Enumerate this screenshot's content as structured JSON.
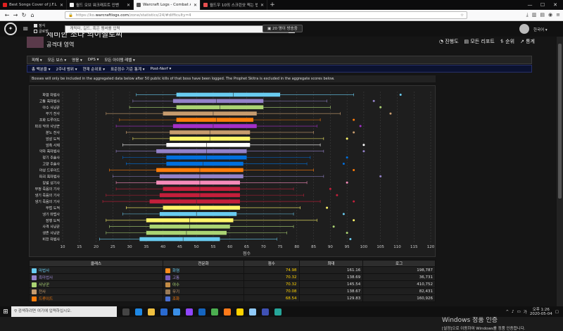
{
  "browser": {
    "tabs": [
      {
        "title": "Best Songs Cover of J.F.L...",
        "color": "#e02020",
        "active": false
      },
      {
        "title": "월드 오브 워크래프트 인벤",
        "color": "#f0f0f0",
        "active": false
      },
      {
        "title": "Warcraft Logs - Combat Anal...",
        "color": "#555555",
        "active": true
      },
      {
        "title": "월드우 10의 스크린샷 찍는 법",
        "color": "#e85050",
        "active": false
      }
    ],
    "new_tab": "+",
    "url_gray": "https://ko.",
    "url_main": "warcraftlogs.com",
    "url_rest": "/zone/statistics/24/#difficulty=4",
    "window": {
      "minimize": "—",
      "maximize": "☐",
      "close": "✕"
    }
  },
  "site": {
    "search_placeholder": "캐릭터, 길드, 혹은 멤버를 입력",
    "opt1": "정식",
    "opt2": "글로벌",
    "live_label": "20 명이 방송중",
    "lang": "한국어 ▾"
  },
  "page": {
    "boss_title": "제비한 조다 의이철로씨",
    "boss_sub": "공격대 영역",
    "links": [
      "진행도",
      "모든 리포트",
      "순위",
      "통계"
    ],
    "filters1": [
      "피해 ▾",
      "모든 보스 ▾",
      "영웅 ▾",
      "DPS ▾",
      "모든 아이템 레벨 ▾"
    ],
    "filters2": [
      "총 백분율 ▾",
      "2주내 범위 ▾",
      "현재 순위표 ▾",
      "표준점수 기준 통계 ▾",
      "Post-Nerf ▾"
    ],
    "notice": "Bosses will only be included in the aggregated data below after 50 public kills of that boss have been logged. The Prophet Skitra is excluded in the aggregate scores below."
  },
  "chart_data": {
    "type": "box",
    "xlabel": "점수",
    "xlim": [
      10,
      120
    ],
    "xticks": [
      10,
      15,
      20,
      25,
      30,
      35,
      40,
      45,
      50,
      55,
      60,
      65,
      70,
      75,
      80,
      85,
      90,
      95,
      100,
      105,
      110,
      115,
      120
    ],
    "rows": [
      {
        "spec": "화염 마법사",
        "color": "#69ccf0",
        "min": 32,
        "q1": 44,
        "median": 61,
        "q3": 75,
        "max": 97,
        "outlier": 111
      },
      {
        "spec": "고통 흑마법사",
        "color": "#9482c9",
        "min": 31,
        "q1": 43,
        "median": 56,
        "q3": 70,
        "max": 89,
        "outlier": 103
      },
      {
        "spec": "야수 사냥꾼",
        "color": "#abd473",
        "min": 30,
        "q1": 44,
        "median": 57,
        "q3": 70,
        "max": 90,
        "outlier": 105
      },
      {
        "spec": "무기 전사",
        "color": "#c79c6e",
        "min": 23,
        "q1": 40,
        "median": 55,
        "q3": 68,
        "max": 93,
        "outlier": 108
      },
      {
        "spec": "조화 드루이드",
        "color": "#ff7d0a",
        "min": 27,
        "q1": 44,
        "median": 56,
        "q3": 67,
        "max": 87,
        "outlier": 97
      },
      {
        "spec": "파괴 악마 사냥꾼",
        "color": "#a330c9",
        "min": 26,
        "q1": 43,
        "median": 55,
        "q3": 68,
        "max": 86,
        "outlier": 99
      },
      {
        "spec": "분노 전사",
        "color": "#c79c6e",
        "min": 29,
        "q1": 42,
        "median": 54,
        "q3": 66,
        "max": 85,
        "outlier": 97
      },
      {
        "spec": "암살 도적",
        "color": "#fff569",
        "min": 31,
        "q1": 42,
        "median": 54,
        "q3": 66,
        "max": 88,
        "outlier": 95
      },
      {
        "spec": "암흑 사제",
        "color": "#ffffff",
        "min": 28,
        "q1": 41,
        "median": 53,
        "q3": 66,
        "max": 87,
        "outlier": 100
      },
      {
        "spec": "악마 흑마법사",
        "color": "#9482c9",
        "min": 26,
        "q1": 38,
        "median": 53,
        "q3": 65,
        "max": 88,
        "outlier": 100
      },
      {
        "spec": "정기 주술사",
        "color": "#0070de",
        "min": 28,
        "q1": 41,
        "median": 53,
        "q3": 65,
        "max": 84,
        "outlier": 95
      },
      {
        "spec": "고양 주술사",
        "color": "#0070de",
        "min": 29,
        "q1": 41,
        "median": 52,
        "q3": 64,
        "max": 83,
        "outlier": 94
      },
      {
        "spec": "야성 드루이드",
        "color": "#ff7d0a",
        "min": 24,
        "q1": 38,
        "median": 51,
        "q3": 64,
        "max": 85,
        "outlier": 97
      },
      {
        "spec": "파괴 흑마법사",
        "color": "#9482c9",
        "min": 25,
        "q1": 39,
        "median": 51,
        "q3": 64,
        "max": 88,
        "outlier": 105
      },
      {
        "spec": "징벌 성기사",
        "color": "#f58cba",
        "min": 26,
        "q1": 38,
        "median": 51,
        "q3": 63,
        "max": 83,
        "outlier": 95
      },
      {
        "spec": "부정 죽음의 기사",
        "color": "#c41f3b",
        "min": 26,
        "q1": 40,
        "median": 51,
        "q3": 63,
        "max": 79,
        "outlier": 90
      },
      {
        "spec": "냉기 죽음의 기사",
        "color": "#c41f3b",
        "min": 23,
        "q1": 39,
        "median": 51,
        "q3": 63,
        "max": 82,
        "outlier": 92
      },
      {
        "spec": "냉기 죽음의 기사",
        "color": "#c41f3b",
        "min": 22,
        "q1": 36,
        "median": 50,
        "q3": 63,
        "max": 87,
        "outlier": 97
      },
      {
        "spec": "무법 도적",
        "color": "#fff569",
        "min": 29,
        "q1": 40,
        "median": 51,
        "q3": 63,
        "max": 81,
        "outlier": 89
      },
      {
        "spec": "냉기 마법사",
        "color": "#69ccf0",
        "min": 28,
        "q1": 39,
        "median": 50,
        "q3": 62,
        "max": 79,
        "outlier": 94
      },
      {
        "spec": "잠행 도적",
        "color": "#fff569",
        "min": 23,
        "q1": 35,
        "median": 48,
        "q3": 61,
        "max": 86,
        "outlier": 97
      },
      {
        "spec": "사격 사냥꾼",
        "color": "#abd473",
        "min": 24,
        "q1": 36,
        "median": 48,
        "q3": 60,
        "max": 79,
        "outlier": 91
      },
      {
        "spec": "생존 사냥꾼",
        "color": "#abd473",
        "min": 23,
        "q1": 35,
        "median": 47,
        "q3": 59,
        "max": 77,
        "outlier": 95
      },
      {
        "spec": "비전 마법사",
        "color": "#69ccf0",
        "min": 21,
        "q1": 33,
        "median": 46,
        "q3": 57,
        "max": 74,
        "outlier": 96
      }
    ]
  },
  "table": {
    "headers": [
      "클래스",
      "전문화",
      "점수",
      "최대",
      "로그"
    ],
    "rows": [
      {
        "class": "마법사",
        "class_color": "#69ccf0",
        "spec": "화염",
        "spec_color": "#ff8c1a",
        "score": "74.98",
        "max": "161.16",
        "logs": "198,787"
      },
      {
        "class": "흑마법사",
        "class_color": "#9482c9",
        "spec": "고통",
        "spec_color": "#7a5cc0",
        "score": "70.32",
        "max": "138.69",
        "logs": "36,731"
      },
      {
        "class": "사냥꾼",
        "class_color": "#abd473",
        "spec": "야수",
        "spec_color": "#c28b45",
        "score": "70.32",
        "max": "145.54",
        "logs": "410,752"
      },
      {
        "class": "전사",
        "class_color": "#c79c6e",
        "spec": "무기",
        "spec_color": "#9a7a55",
        "score": "70.08",
        "max": "138.67",
        "logs": "82,431"
      },
      {
        "class": "드루이드",
        "class_color": "#ff7d0a",
        "spec": "조화",
        "spec_color": "#4a6fd0",
        "score": "68.54",
        "max": "129.83",
        "logs": "160,926"
      }
    ]
  },
  "activation": {
    "title": "Windows 정품 인증",
    "subtitle": "[설정]으로 이동하여 Windows를 정품 인증합니다."
  },
  "taskbar": {
    "search_placeholder": "검색하려면 여기에 입력하십시오.",
    "time": "오후 1:26",
    "date": "2020-05-04"
  },
  "colors": {
    "accent": "#ffd200",
    "filter_bar": "#0b1230"
  }
}
